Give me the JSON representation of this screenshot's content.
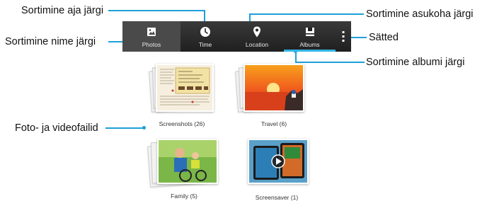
{
  "callouts": {
    "sort_by_time": "Sortimine aja järgi",
    "sort_by_name": "Sortimine nime järgi",
    "sort_by_location": "Sortimine asukoha järgi",
    "settings": "Sätted",
    "sort_by_album": "Sortimine albumi järgi",
    "photo_video_files": "Foto- ja videofailid"
  },
  "toolbar": {
    "tabs": [
      {
        "label": "Photos",
        "icon": "image-icon",
        "active": true
      },
      {
        "label": "Time",
        "icon": "clock-icon",
        "active": false
      },
      {
        "label": "Location",
        "icon": "location-pin-icon",
        "active": false
      },
      {
        "label": "Albums",
        "icon": "album-icon",
        "active": false
      }
    ],
    "menu_icon": "overflow-menu-icon"
  },
  "albums": [
    {
      "caption": "Screenshots (26)"
    },
    {
      "caption": "Travel (6)"
    },
    {
      "caption": "Family (5)"
    },
    {
      "caption": "Screensaver (1)"
    }
  ],
  "colors": {
    "callout_line": "#1ea0d8",
    "toolbar": "#2a2a2a",
    "accent": "#33b5e5"
  }
}
